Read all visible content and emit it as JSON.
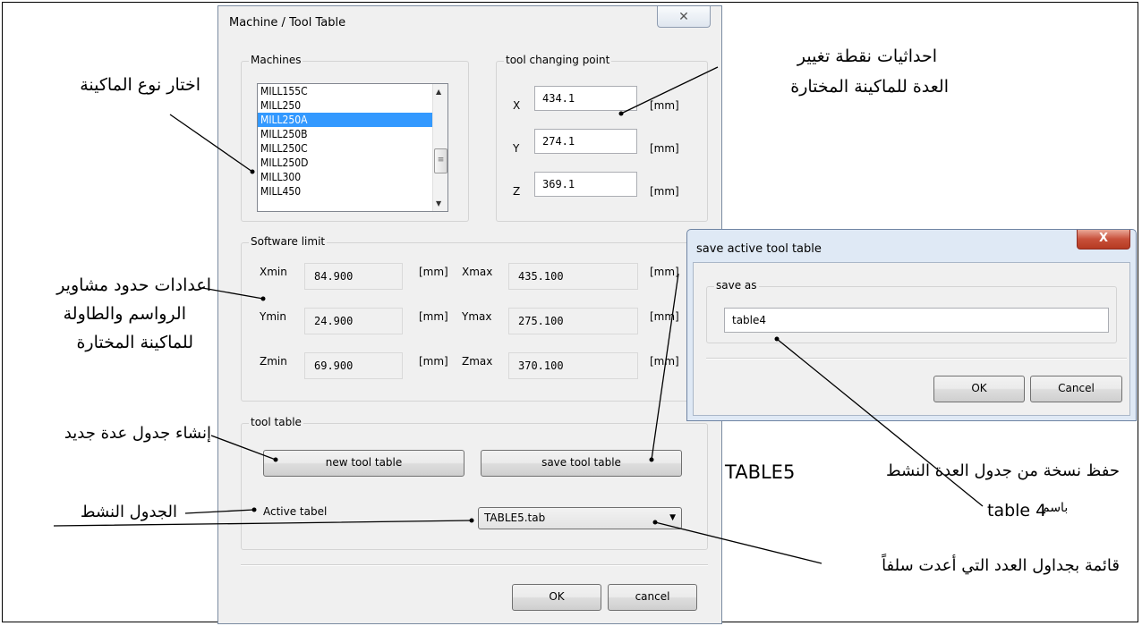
{
  "main_dialog": {
    "title": "Machine / Tool Table",
    "close_glyph": "✕",
    "machines": {
      "label": "Machines",
      "items": [
        "MILL155C",
        "MILL250",
        "MILL250A",
        "MILL250B",
        "MILL250C",
        "MILL250D",
        "MILL300",
        "MILL450"
      ],
      "selected": "MILL250A"
    },
    "tool_changing_point": {
      "label": "tool changing point",
      "x_label": "X",
      "x_value": "434.1",
      "y_label": "Y",
      "y_value": "274.1",
      "z_label": "Z",
      "z_value": "369.1",
      "unit": "[mm]"
    },
    "software_limit": {
      "label": "Software limit",
      "xmin_label": "Xmin",
      "xmin": "84.900",
      "xmax_label": "Xmax",
      "xmax": "435.100",
      "ymin_label": "Ymin",
      "ymin": "24.900",
      "ymax_label": "Ymax",
      "ymax": "275.100",
      "zmin_label": "Zmin",
      "zmin": "69.900",
      "zmax_label": "Zmax",
      "zmax": "370.100",
      "unit": "[mm]"
    },
    "tool_table": {
      "label": "tool table",
      "new_button": "new tool table",
      "save_button": "save tool table",
      "active_label": "Active tabel",
      "active_value": "TABLE5.tab"
    },
    "ok_button": "OK",
    "cancel_button": "cancel"
  },
  "save_dialog": {
    "title": "save active tool table",
    "close_glyph": "X",
    "group_label": "save as",
    "input_value": "table4",
    "ok_button": "OK",
    "cancel_button": "Cancel"
  },
  "annotations": {
    "choose_machine": "اختار نوع الماكينة",
    "tool_change_coords_1": "احداثيات نقطة تغيير",
    "tool_change_coords_2": "العدة للماكينة المختارة",
    "limits_1": "اعدادات حدود مشاوير",
    "limits_2": "الرواسم والطاولة",
    "limits_3": "للماكينة المختارة",
    "new_table": "إنشاء جدول عدة جديد",
    "active_table": "الجدول النشط",
    "save_copy_1": "حفظ نسخة من جدول العدة النشط",
    "save_copy_table5": "TABLE5",
    "save_copy_2": "باسم",
    "save_copy_table4": "table 4",
    "list_tables": "قائمة بجداول العدد التي أعدت سلفاً"
  }
}
